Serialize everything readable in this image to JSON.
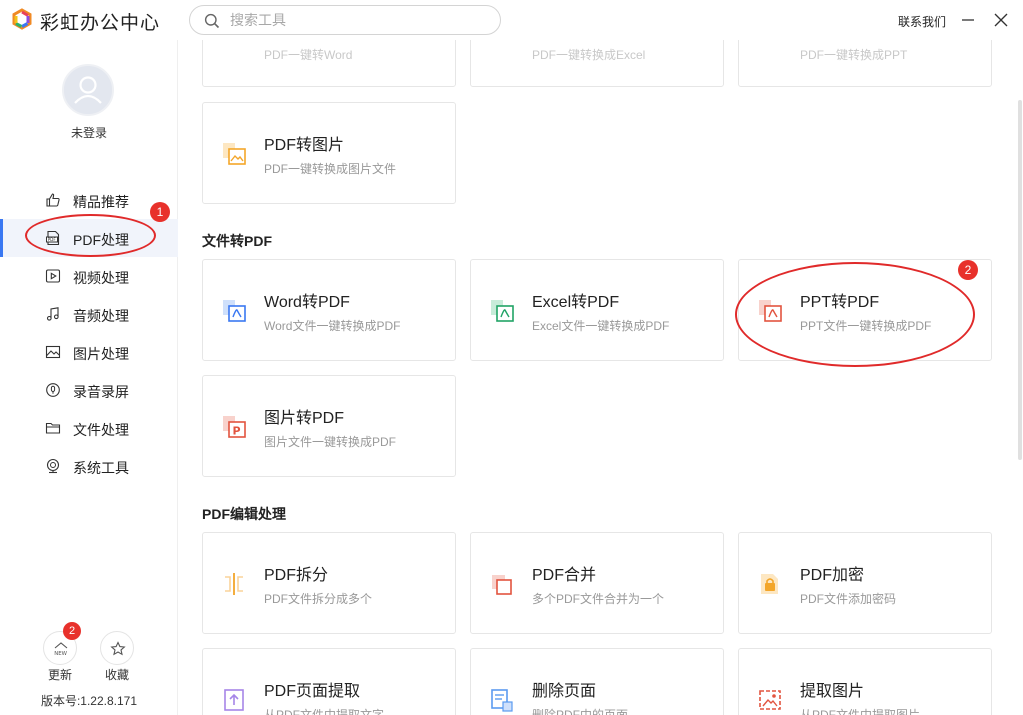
{
  "app": {
    "title": "彩虹办公中心"
  },
  "search": {
    "placeholder": "搜索工具"
  },
  "header": {
    "contact": "联系我们"
  },
  "user": {
    "status": "未登录"
  },
  "sidebar": {
    "items": [
      {
        "label": "精品推荐",
        "icon": "thumbs-up-icon"
      },
      {
        "label": "PDF处理",
        "icon": "pdf-file-icon"
      },
      {
        "label": "视频处理",
        "icon": "video-icon"
      },
      {
        "label": "音频处理",
        "icon": "music-note-icon"
      },
      {
        "label": "图片处理",
        "icon": "image-icon"
      },
      {
        "label": "录音录屏",
        "icon": "record-icon"
      },
      {
        "label": "文件处理",
        "icon": "folder-icon"
      },
      {
        "label": "系统工具",
        "icon": "monitor-icon"
      }
    ],
    "active_index": 1,
    "update_label": "更新",
    "update_badge": "2",
    "update_icon_text": "NEW",
    "favorite_label": "收藏",
    "version": "版本号:1.22.8.171"
  },
  "annotations": {
    "badge1": "1",
    "badge2": "2"
  },
  "partial_top_cards": [
    {
      "desc": "PDF一键转Word"
    },
    {
      "desc": "PDF一键转换成Excel"
    },
    {
      "desc": "PDF一键转换成PPT"
    }
  ],
  "pdf_to_image": {
    "title": "PDF转图片",
    "desc": "PDF一键转换成图片文件"
  },
  "sections": {
    "to_pdf": {
      "title": "文件转PDF",
      "cards": [
        {
          "title": "Word转PDF",
          "desc": "Word文件一键转换成PDF",
          "icon": "word-to-pdf-icon"
        },
        {
          "title": "Excel转PDF",
          "desc": "Excel文件一键转换成PDF",
          "icon": "excel-to-pdf-icon"
        },
        {
          "title": "PPT转PDF",
          "desc": "PPT文件一键转换成PDF",
          "icon": "ppt-to-pdf-icon"
        },
        {
          "title": "图片转PDF",
          "desc": "图片文件一键转换成PDF",
          "icon": "image-to-pdf-icon"
        }
      ]
    },
    "edit": {
      "title": "PDF编辑处理",
      "cards": [
        {
          "title": "PDF拆分",
          "desc": "PDF文件拆分成多个",
          "icon": "split-icon"
        },
        {
          "title": "PDF合并",
          "desc": "多个PDF文件合并为一个",
          "icon": "merge-icon"
        },
        {
          "title": "PDF加密",
          "desc": "PDF文件添加密码",
          "icon": "lock-icon"
        },
        {
          "title": "PDF页面提取",
          "desc": "从PDF文件中提取文字",
          "icon": "extract-page-icon"
        },
        {
          "title": "删除页面",
          "desc": "删除PDF中的页面",
          "icon": "delete-page-icon"
        },
        {
          "title": "提取图片",
          "desc": "从PDF文件中提取图片",
          "icon": "extract-image-icon"
        }
      ]
    }
  },
  "colors": {
    "accent": "#3a78f2",
    "annotation": "#e02a2a",
    "badge": "#e8312b"
  }
}
